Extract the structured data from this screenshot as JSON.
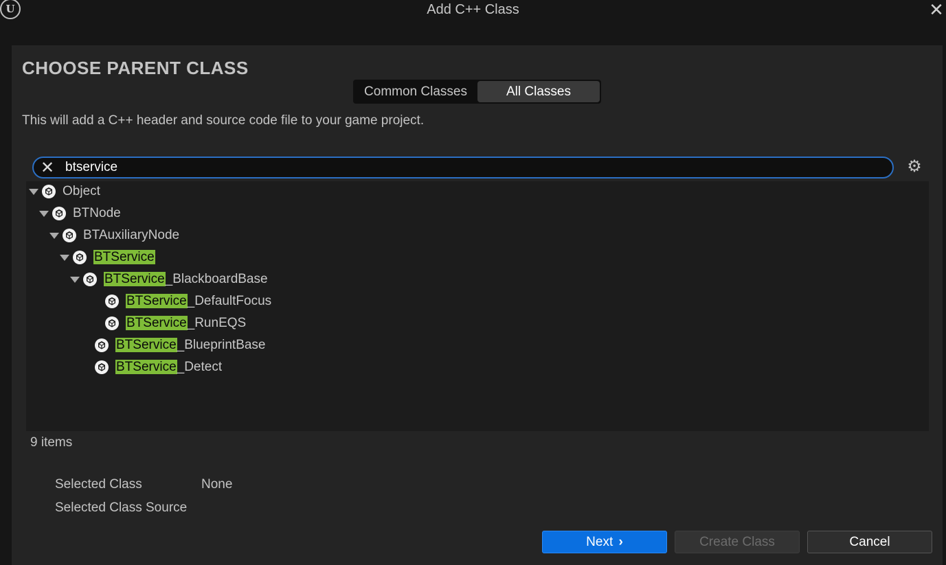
{
  "window": {
    "title": "Add C++ Class",
    "logo": "unreal-logo",
    "logo_text": "U",
    "close_glyph": "✕"
  },
  "heading": "CHOOSE PARENT CLASS",
  "tabs": [
    {
      "label": "Common Classes",
      "selected": false
    },
    {
      "label": "All Classes",
      "selected": true
    }
  ],
  "description": "This will add a C++ header and source code file to your game project.",
  "search": {
    "value": "btservice",
    "clear_glyph": "✕",
    "settings_glyph": "⚙"
  },
  "tree": [
    {
      "prefix": "",
      "name": "Object",
      "expanded": true
    },
    {
      "prefix": "",
      "name": "BTNode",
      "expanded": true
    },
    {
      "prefix": "",
      "name": "BTAuxiliaryNode",
      "expanded": true
    },
    {
      "prefix": "BTService",
      "name": "",
      "expanded": true
    },
    {
      "prefix": "BTService",
      "name": "_BlackboardBase",
      "expanded": true
    },
    {
      "prefix": "BTService",
      "name": "_DefaultFocus",
      "expanded": false
    },
    {
      "prefix": "BTService",
      "name": "_RunEQS",
      "expanded": false
    },
    {
      "prefix": "BTService",
      "name": "_BlueprintBase",
      "expanded": false
    },
    {
      "prefix": "BTService",
      "name": "_Detect",
      "expanded": false
    }
  ],
  "item_count": "9 items",
  "selected_class_label": "Selected Class",
  "selected_class_value": "None",
  "selected_class_source_label": "Selected Class Source",
  "buttons": {
    "next": "Next",
    "next_glyph": "›",
    "create_class": "Create Class",
    "cancel": "Cancel"
  },
  "colors": {
    "accent": "#0a6fe0",
    "highlight": "#7fbc38",
    "search_border": "#2b6fc4"
  }
}
